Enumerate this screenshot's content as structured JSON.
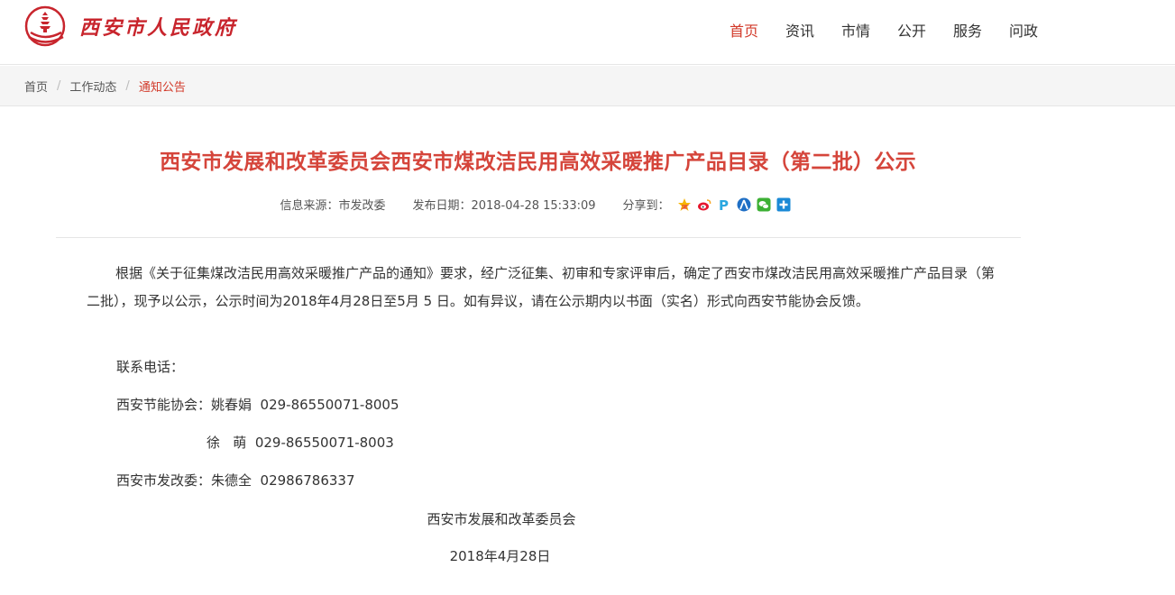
{
  "header": {
    "site_name": "西安市人民政府",
    "nav": [
      {
        "label": "首页",
        "active": true
      },
      {
        "label": "资讯",
        "active": false
      },
      {
        "label": "市情",
        "active": false
      },
      {
        "label": "公开",
        "active": false
      },
      {
        "label": "服务",
        "active": false
      },
      {
        "label": "问政",
        "active": false
      }
    ]
  },
  "breadcrumb": [
    "首页",
    "工作动态",
    "通知公告"
  ],
  "article": {
    "title": "西安市发展和改革委员会西安市煤改洁民用高效采暖推广产品目录（第二批）公示",
    "source": "信息来源：市发改委",
    "date": "发布日期：2018-04-28 15:33:09",
    "share_label": "分享到：",
    "share_icons": [
      "qzone-icon",
      "weibo-icon",
      "pengyou-icon",
      "renren-icon",
      "wechat-icon",
      "more-share-icon"
    ],
    "body_intro": "根据《关于征集煤改洁民用高效采暖推广产品的通知》要求，经广泛征集、初审和专家评审后，确定了西安市煤改洁民用高效采暖推广产品目录（第二批），现予以公示，公示时间为2018年4月28日至5月 5 日。如有异议，请在公示期内以书面（实名）形式向西安节能协会反馈。",
    "contact_label": "联系电话：",
    "contact_1": "西安节能协会：姚春娟  029-86550071-8005",
    "contact_2": "徐   萌  029-86550071-8003",
    "contact_3": "西安市发改委：朱德全  02986786337",
    "signature": "西安市发展和改革委员会",
    "sign_date": "2018年4月28日"
  },
  "colors": {
    "accent": "#d23a2a",
    "title": "#d5453b"
  }
}
